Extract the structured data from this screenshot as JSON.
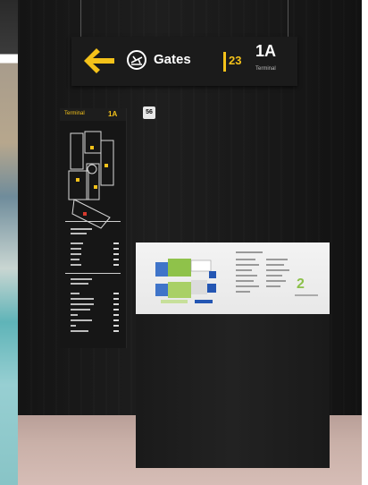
{
  "overhead_sign": {
    "destination": "Gates",
    "gate_range": "23",
    "terminal_code": "1A",
    "terminal_word": "Terminal",
    "arrow": "left-arrow-icon",
    "icon": "departing-plane-icon",
    "accent_color": "#f4c21a"
  },
  "badge": {
    "text": "56"
  },
  "totem": {
    "title": "Terminal",
    "code": "1A"
  },
  "kiosk": {
    "level": "2"
  }
}
